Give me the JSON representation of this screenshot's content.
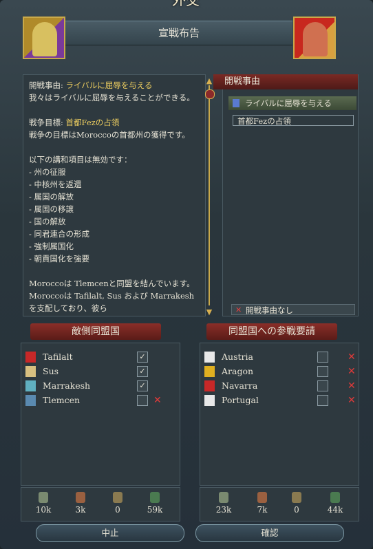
{
  "window_title": "外交",
  "header_title": "宣戦布告",
  "description": {
    "cb_label": "開戦事由: ",
    "cb_value": "ライバルに屈辱を与える",
    "cb_desc": "我々はライバルに屈辱を与えることができる。",
    "goal_label": "戦争目標: ",
    "goal_value": "首都Fezの占領",
    "goal_desc": "戦争の目標はMoroccoの首都州の獲得です。",
    "invalid_title": "以下の講和項目は無効です：",
    "invalid_items": [
      "- 州の征服",
      "- 中核州を返還",
      "- 属国の解放",
      "- 属国の移譲",
      "- 国の解放",
      "- 同君連合の形成",
      "- 強制属国化",
      "- 朝貢国化を強要"
    ],
    "alliance_text": "Moroccoは Tlemcenと同盟を結んでいます。 Moroccoは Tafilalt, Sus および Marrakeshを支配しており、彼ら"
  },
  "casus_belli": {
    "header": "開戦事由",
    "selected": "ライバルに屈辱を与える",
    "goal": "首都Fezの占領",
    "none": "開戦事由なし"
  },
  "enemy_allies": {
    "title": "敵側同盟国",
    "rows": [
      {
        "name": "Tafilalt",
        "checked": "✓"
      },
      {
        "name": "Sus",
        "checked": "✓"
      },
      {
        "name": "Marrakesh",
        "checked": "✓"
      },
      {
        "name": "Tlemcen",
        "checked": ""
      }
    ],
    "stats": [
      "10k",
      "3k",
      "0",
      "59k"
    ]
  },
  "ally_requests": {
    "title": "同盟国への参戦要請",
    "rows": [
      {
        "name": "Austria",
        "checked": ""
      },
      {
        "name": "Aragon",
        "checked": ""
      },
      {
        "name": "Navarra",
        "checked": ""
      },
      {
        "name": "Portugal",
        "checked": ""
      }
    ],
    "stats": [
      "23k",
      "7k",
      "0",
      "44k"
    ]
  },
  "buttons": {
    "cancel": "中止",
    "confirm": "確認"
  },
  "icons": {
    "delete": "✕",
    "scroll_up": "▲",
    "scroll_down": "▼"
  },
  "colors": {
    "banner_red": "#8a2e28",
    "highlight": "#f0d060",
    "delete_red": "#e03a3a"
  }
}
